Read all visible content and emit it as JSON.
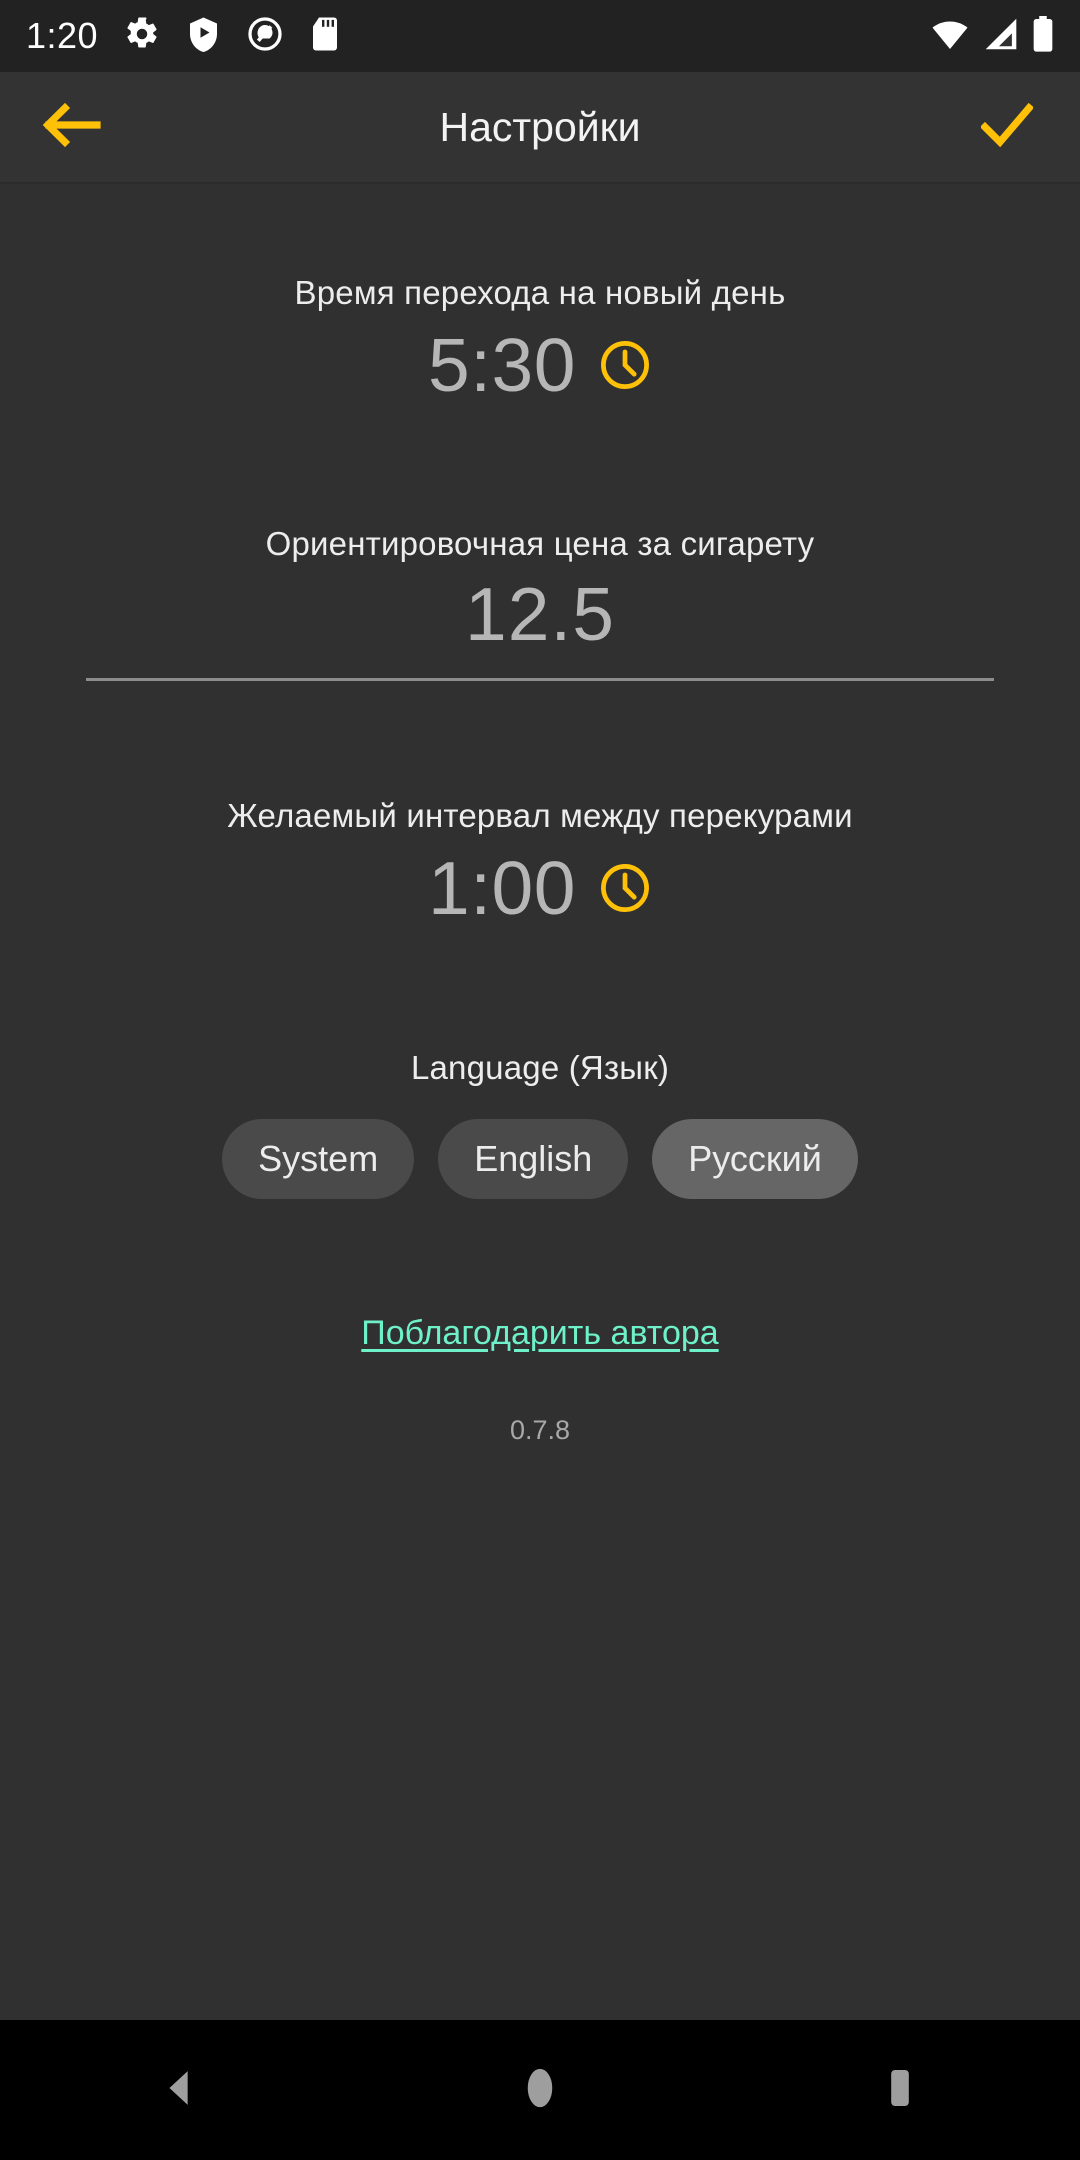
{
  "status_bar": {
    "time": "1:20",
    "left_icons": [
      "gear-icon",
      "play-shield-icon",
      "app-circle-icon",
      "sd-card-icon"
    ],
    "right_icons": [
      "wifi-icon",
      "cellular-signal-icon",
      "battery-icon"
    ]
  },
  "app_bar": {
    "title": "Настройки",
    "back_icon": "back-arrow-icon",
    "confirm_icon": "checkmark-icon",
    "accent_color": "#FFC107"
  },
  "sections": {
    "day_start": {
      "label": "Время перехода на новый день",
      "value": "5:30",
      "icon": "clock-icon"
    },
    "cigarette_price": {
      "label": "Ориентировочная цена за сигарету",
      "value": "12.5"
    },
    "smoke_interval": {
      "label": "Желаемый интервал между перекурами",
      "value": "1:00",
      "icon": "clock-icon"
    },
    "language": {
      "label": "Language (Язык)",
      "options": [
        {
          "label": "System",
          "selected": false
        },
        {
          "label": "English",
          "selected": false
        },
        {
          "label": "Русский",
          "selected": true
        }
      ]
    }
  },
  "footer": {
    "donate_link": "Поблагодарить автора",
    "version": "0.7.8",
    "link_color": "#6EF0C8"
  },
  "nav_bar": {
    "back": "nav-back-icon",
    "home": "nav-home-icon",
    "recents": "nav-recents-icon"
  },
  "theme": {
    "background": "#303030",
    "app_bar_background": "#333333",
    "status_bar_background": "#222222",
    "accent": "#FFC107",
    "value_text": "#B6B6B6",
    "chip_unselected": "#4A4A4A",
    "chip_selected": "#666666"
  }
}
